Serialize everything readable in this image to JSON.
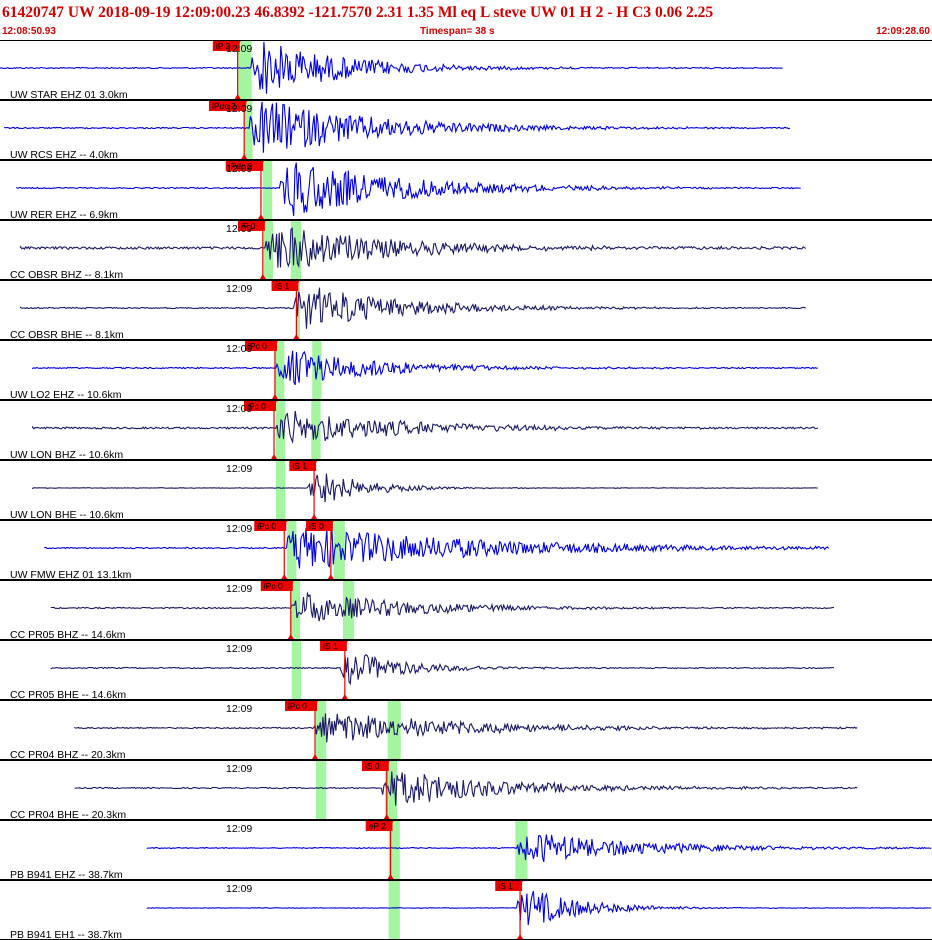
{
  "header": {
    "title": "61420747 UW 2018-09-19 12:09:00.23   46.8392 -121.7570   2.31  1.35 Ml  eq  L steve    UW 01  H   2  -  H C3    0.06  2.25",
    "start_time": "12:08:50.93",
    "timespan": "Timespan=  38 s",
    "end_time": "12:09:28.60"
  },
  "colors": {
    "background": "#ffffff",
    "header_text": "#d40000",
    "trace_blue": "#0000dd",
    "trace_navy": "#1a1a66",
    "pick_flag": "#ee0000",
    "pick_window": "#a4f5a0",
    "panel_border": "#000000"
  },
  "traces": [
    {
      "label": "UW STAR EHZ 01 3.0km",
      "time_label": "12:09",
      "color": "navy_or_blue",
      "style": "blue",
      "start": 0.0,
      "end": 0.84,
      "onset": 0.27,
      "noise": 0.02,
      "amp": 0.55,
      "decay": 0.09,
      "picks": [
        {
          "label": "iP 2",
          "pos": 0.255,
          "window": [
            0.255,
            0.27
          ]
        }
      ]
    },
    {
      "label": "UW RCS EHZ -- 4.0km",
      "time_label": "12:09",
      "color": "blue",
      "style": "blue",
      "start": 0.005,
      "end": 0.848,
      "onset": 0.268,
      "noise": 0.02,
      "amp": 0.55,
      "decay": 0.12,
      "picks": [
        {
          "label": "iPdc 2",
          "pos": 0.262,
          "window": [
            0.262,
            0.271
          ]
        }
      ]
    },
    {
      "label": "UW RER EHZ -- 6.9km",
      "time_label": "12:09",
      "color": "blue",
      "style": "blue",
      "start": 0.018,
      "end": 0.86,
      "onset": 0.3,
      "noise": 0.02,
      "amp": 0.55,
      "decay": 0.12,
      "picks": [
        {
          "label": "iPdc 2",
          "pos": 0.28,
          "window": [
            0.282,
            0.292
          ]
        }
      ]
    },
    {
      "label": "CC OBSR BHZ -- 8.1km",
      "time_label": "12:09",
      "color": "navy",
      "style": "navy",
      "start": 0.022,
      "end": 0.865,
      "onset": 0.285,
      "noise": 0.04,
      "amp": 0.45,
      "decay": 0.12,
      "picks": [
        {
          "label": "iP 0",
          "pos": 0.282,
          "window": [
            0.283,
            0.293
          ]
        },
        {
          "label": "",
          "pos": 0.0,
          "window": [
            0.312,
            0.323
          ]
        }
      ]
    },
    {
      "label": "CC OBSR BHE -- 8.1km",
      "time_label": "12:09",
      "color": "navy",
      "style": "navy",
      "start": 0.022,
      "end": 0.865,
      "onset": 0.315,
      "noise": 0.02,
      "amp": 0.45,
      "decay": 0.1,
      "picks": [
        {
          "label": "iS 1",
          "pos": 0.318,
          "window": [
            0.318,
            0.322
          ]
        }
      ]
    },
    {
      "label": "UW LO2 EHZ -- 10.6km",
      "time_label": "12:09",
      "color": "blue",
      "style": "blue",
      "start": 0.035,
      "end": 0.878,
      "onset": 0.297,
      "noise": 0.02,
      "amp": 0.35,
      "decay": 0.1,
      "picks": [
        {
          "label": "iPc 0",
          "pos": 0.295,
          "window": [
            0.295,
            0.305
          ]
        },
        {
          "label": "",
          "pos": 0.34,
          "window": [
            0.335,
            0.345
          ]
        }
      ]
    },
    {
      "label": "UW LON BHZ -- 10.6km",
      "time_label": "12:09",
      "color": "navy",
      "style": "navy",
      "start": 0.035,
      "end": 0.878,
      "onset": 0.296,
      "noise": 0.03,
      "amp": 0.35,
      "decay": 0.12,
      "picks": [
        {
          "label": "iPc 0",
          "pos": 0.294,
          "window": [
            0.296,
            0.306
          ]
        },
        {
          "label": "",
          "pos": 0.0,
          "window": [
            0.334,
            0.344
          ]
        }
      ]
    },
    {
      "label": "UW LON BHE -- 10.6km",
      "time_label": "12:09",
      "color": "navy",
      "style": "navy",
      "start": 0.035,
      "end": 0.878,
      "onset": 0.33,
      "noise": 0.01,
      "amp": 0.4,
      "decay": 0.05,
      "picks": [
        {
          "label": "iS 1",
          "pos": 0.337,
          "window": [
            0.296,
            0.306
          ]
        }
      ]
    },
    {
      "label": "UW FMW EHZ 01 13.1km",
      "time_label": "12:09",
      "color": "blue",
      "style": "blue",
      "start": 0.048,
      "end": 0.89,
      "onset": 0.308,
      "noise": 0.02,
      "amp": 0.4,
      "decay": 0.2,
      "picks": [
        {
          "label": "iPc 0",
          "pos": 0.305,
          "window": [
            0.308,
            0.318
          ]
        },
        {
          "label": "iS 0",
          "pos": 0.355,
          "window": [
            0.358,
            0.37
          ]
        }
      ]
    },
    {
      "label": "CC PR05 BHZ -- 14.6km",
      "time_label": "12:09",
      "color": "navy",
      "style": "navy",
      "start": 0.055,
      "end": 0.896,
      "onset": 0.312,
      "noise": 0.02,
      "amp": 0.3,
      "decay": 0.12,
      "picks": [
        {
          "label": "iPc 0",
          "pos": 0.312,
          "window": [
            0.312,
            0.322
          ]
        },
        {
          "label": "",
          "pos": 0.0,
          "window": [
            0.368,
            0.38
          ]
        }
      ]
    },
    {
      "label": "CC PR05 BHE -- 14.6km",
      "time_label": "12:09",
      "color": "navy",
      "style": "navy",
      "start": 0.055,
      "end": 0.896,
      "onset": 0.365,
      "noise": 0.02,
      "amp": 0.35,
      "decay": 0.06,
      "picks": [
        {
          "label": "iS 1",
          "pos": 0.37,
          "window": [
            0.313,
            0.323
          ]
        }
      ]
    },
    {
      "label": "CC PR04 BHZ -- 20.3km",
      "time_label": "12:09",
      "color": "navy",
      "style": "navy",
      "start": 0.08,
      "end": 0.92,
      "onset": 0.338,
      "noise": 0.02,
      "amp": 0.3,
      "decay": 0.15,
      "picks": [
        {
          "label": "iPc 0",
          "pos": 0.338,
          "window": [
            0.339,
            0.35
          ]
        },
        {
          "label": "",
          "pos": 0.0,
          "window": [
            0.416,
            0.43
          ]
        }
      ]
    },
    {
      "label": "CC PR04 BHE -- 20.3km",
      "time_label": "12:09",
      "color": "navy",
      "style": "navy",
      "start": 0.08,
      "end": 0.92,
      "onset": 0.41,
      "noise": 0.02,
      "amp": 0.35,
      "decay": 0.12,
      "picks": [
        {
          "label": "iS 0",
          "pos": 0.415,
          "window": [
            0.339,
            0.35
          ]
        },
        {
          "label": "",
          "pos": 0.0,
          "window": [
            0.413,
            0.426
          ]
        }
      ]
    },
    {
      "label": "PB B941 EHZ -- 38.7km",
      "time_label": "12:09",
      "color": "blue",
      "style": "blue",
      "start": 0.158,
      "end": 1.0,
      "onset": 0.555,
      "noise": 0.015,
      "amp": 0.3,
      "decay": 0.12,
      "picks": [
        {
          "label": "eP 2",
          "pos": 0.419,
          "window": [
            0.417,
            0.429
          ]
        },
        {
          "label": "",
          "pos": 0.0,
          "window": [
            0.553,
            0.566
          ]
        }
      ]
    },
    {
      "label": "PB B941 EH1 -- 38.7km",
      "time_label": "12:09",
      "color": "blue",
      "style": "blue",
      "start": 0.158,
      "end": 1.0,
      "onset": 0.555,
      "noise": 0.01,
      "amp": 0.4,
      "decay": 0.06,
      "picks": [
        {
          "label": "iS 1",
          "pos": 0.558,
          "window": [
            0.417,
            0.429
          ]
        }
      ]
    }
  ]
}
